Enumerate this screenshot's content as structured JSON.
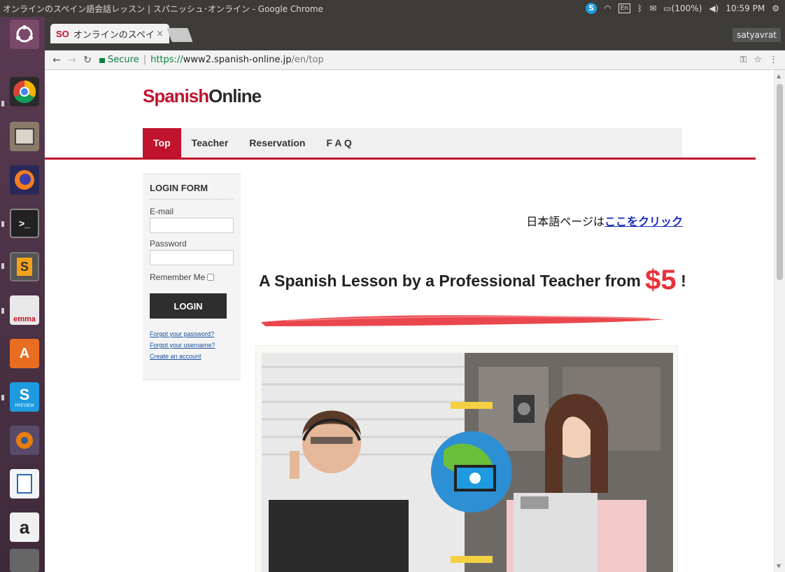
{
  "system": {
    "window_title": "オンラインのスペイン語会話レッスン | スパニッシュ･オンライン - Google Chrome",
    "battery": "(100%)",
    "time": "10:59 PM",
    "keyboard": "En"
  },
  "launcher": {
    "items": [
      "ubuntu-dash-icon",
      "chrome-icon",
      "files-icon",
      "firefox-icon",
      "terminal-icon",
      "sublime-text-icon",
      "mysql-workbench-icon",
      "software-center-icon",
      "skype-preview-icon",
      "blender-icon",
      "libreoffice-writer-icon",
      "amazon-icon",
      "trash-icon"
    ],
    "mysql_label": "emma",
    "skype_badge": "PREVIEW"
  },
  "browser": {
    "tab_title": "オンラインのスペイ",
    "tab_favicon": "SO",
    "tab_close": "×",
    "profile": "satyavrat",
    "secure_label": "Secure",
    "url_scheme": "https://",
    "url_host": "www2.spanish-online.jp",
    "url_path": "/en/top"
  },
  "site": {
    "logo_part1": "Spanish",
    "logo_part2": "Online",
    "nav": [
      "Top",
      "Teacher",
      "Reservation",
      "F A Q"
    ],
    "login": {
      "title": "LOGIN FORM",
      "email_label": "E-mail",
      "password_label": "Password",
      "remember_label": "Remember Me",
      "button": "LOGIN",
      "forgot_password": "Forgot your password?",
      "forgot_username": "Forgot your username?",
      "create_account": "Create an account"
    },
    "jp_prefix": "日本語ページは",
    "jp_link": "ここをクリック",
    "headline": "A Spanish Lesson by a Professional Teacher from",
    "price": "$5",
    "exclaim": "!"
  },
  "colors": {
    "brand_red": "#c0132d",
    "price_red": "#e8323a",
    "link_blue": "#1a2fbf"
  }
}
